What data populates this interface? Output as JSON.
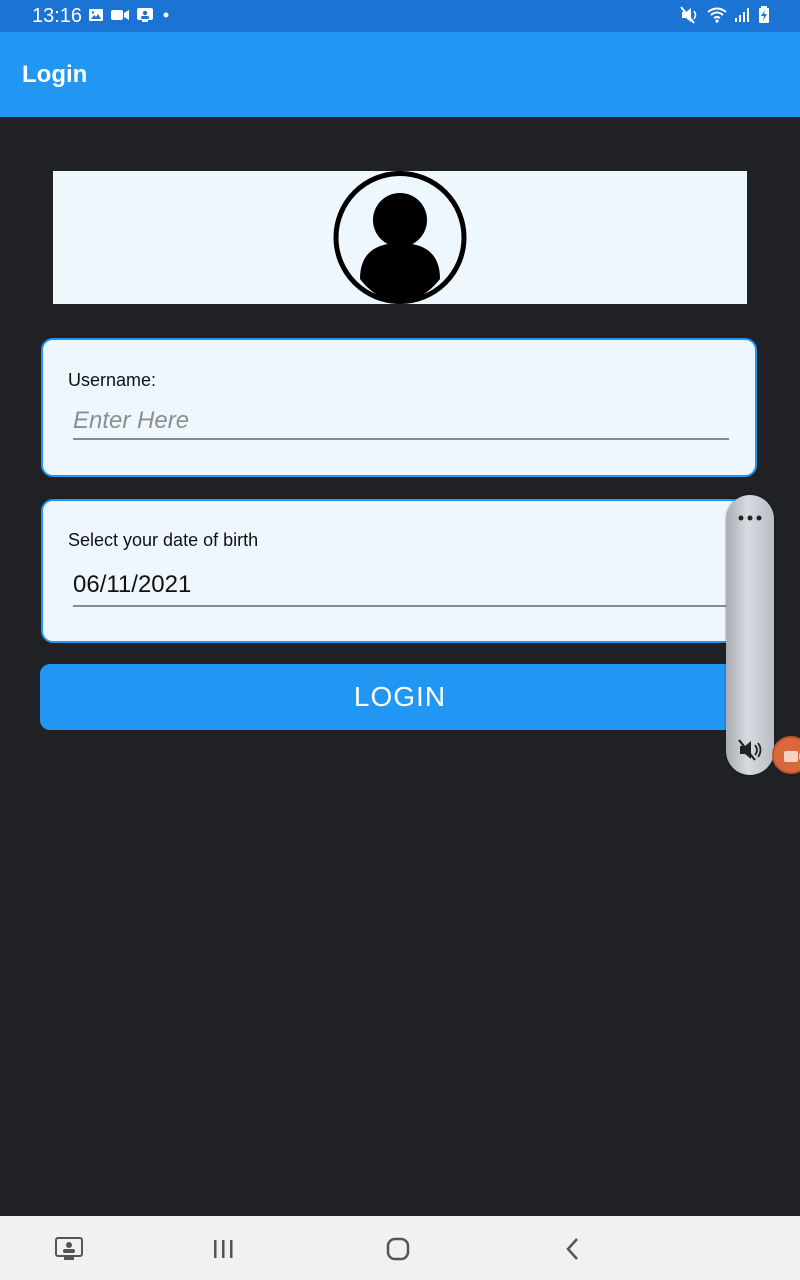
{
  "status_bar": {
    "time": "13:16",
    "left_icons": [
      "image-icon",
      "video-icon",
      "notification-icon",
      "dot-icon"
    ],
    "right_icons": [
      "mute-icon",
      "wifi-icon",
      "signal-icon",
      "battery-icon"
    ]
  },
  "app_bar": {
    "title": "Login"
  },
  "avatar": {
    "icon": "user-avatar-icon"
  },
  "form": {
    "username_label": "Username:",
    "username_placeholder": "Enter Here",
    "username_value": "",
    "dob_label": "Select your date of birth",
    "dob_value": "06/11/2021",
    "login_button": "LOGIN"
  },
  "volume_panel": {
    "icons": [
      "more-icon",
      "mute-icon"
    ]
  },
  "nav_bar": {
    "items": [
      "screenshot-icon",
      "recents-icon",
      "home-icon",
      "back-icon"
    ]
  },
  "colors": {
    "status_bar": "#1b73d3",
    "app_bar": "#2196f3",
    "background": "#202124",
    "card": "#eef7fe",
    "accent": "#2196f3"
  }
}
